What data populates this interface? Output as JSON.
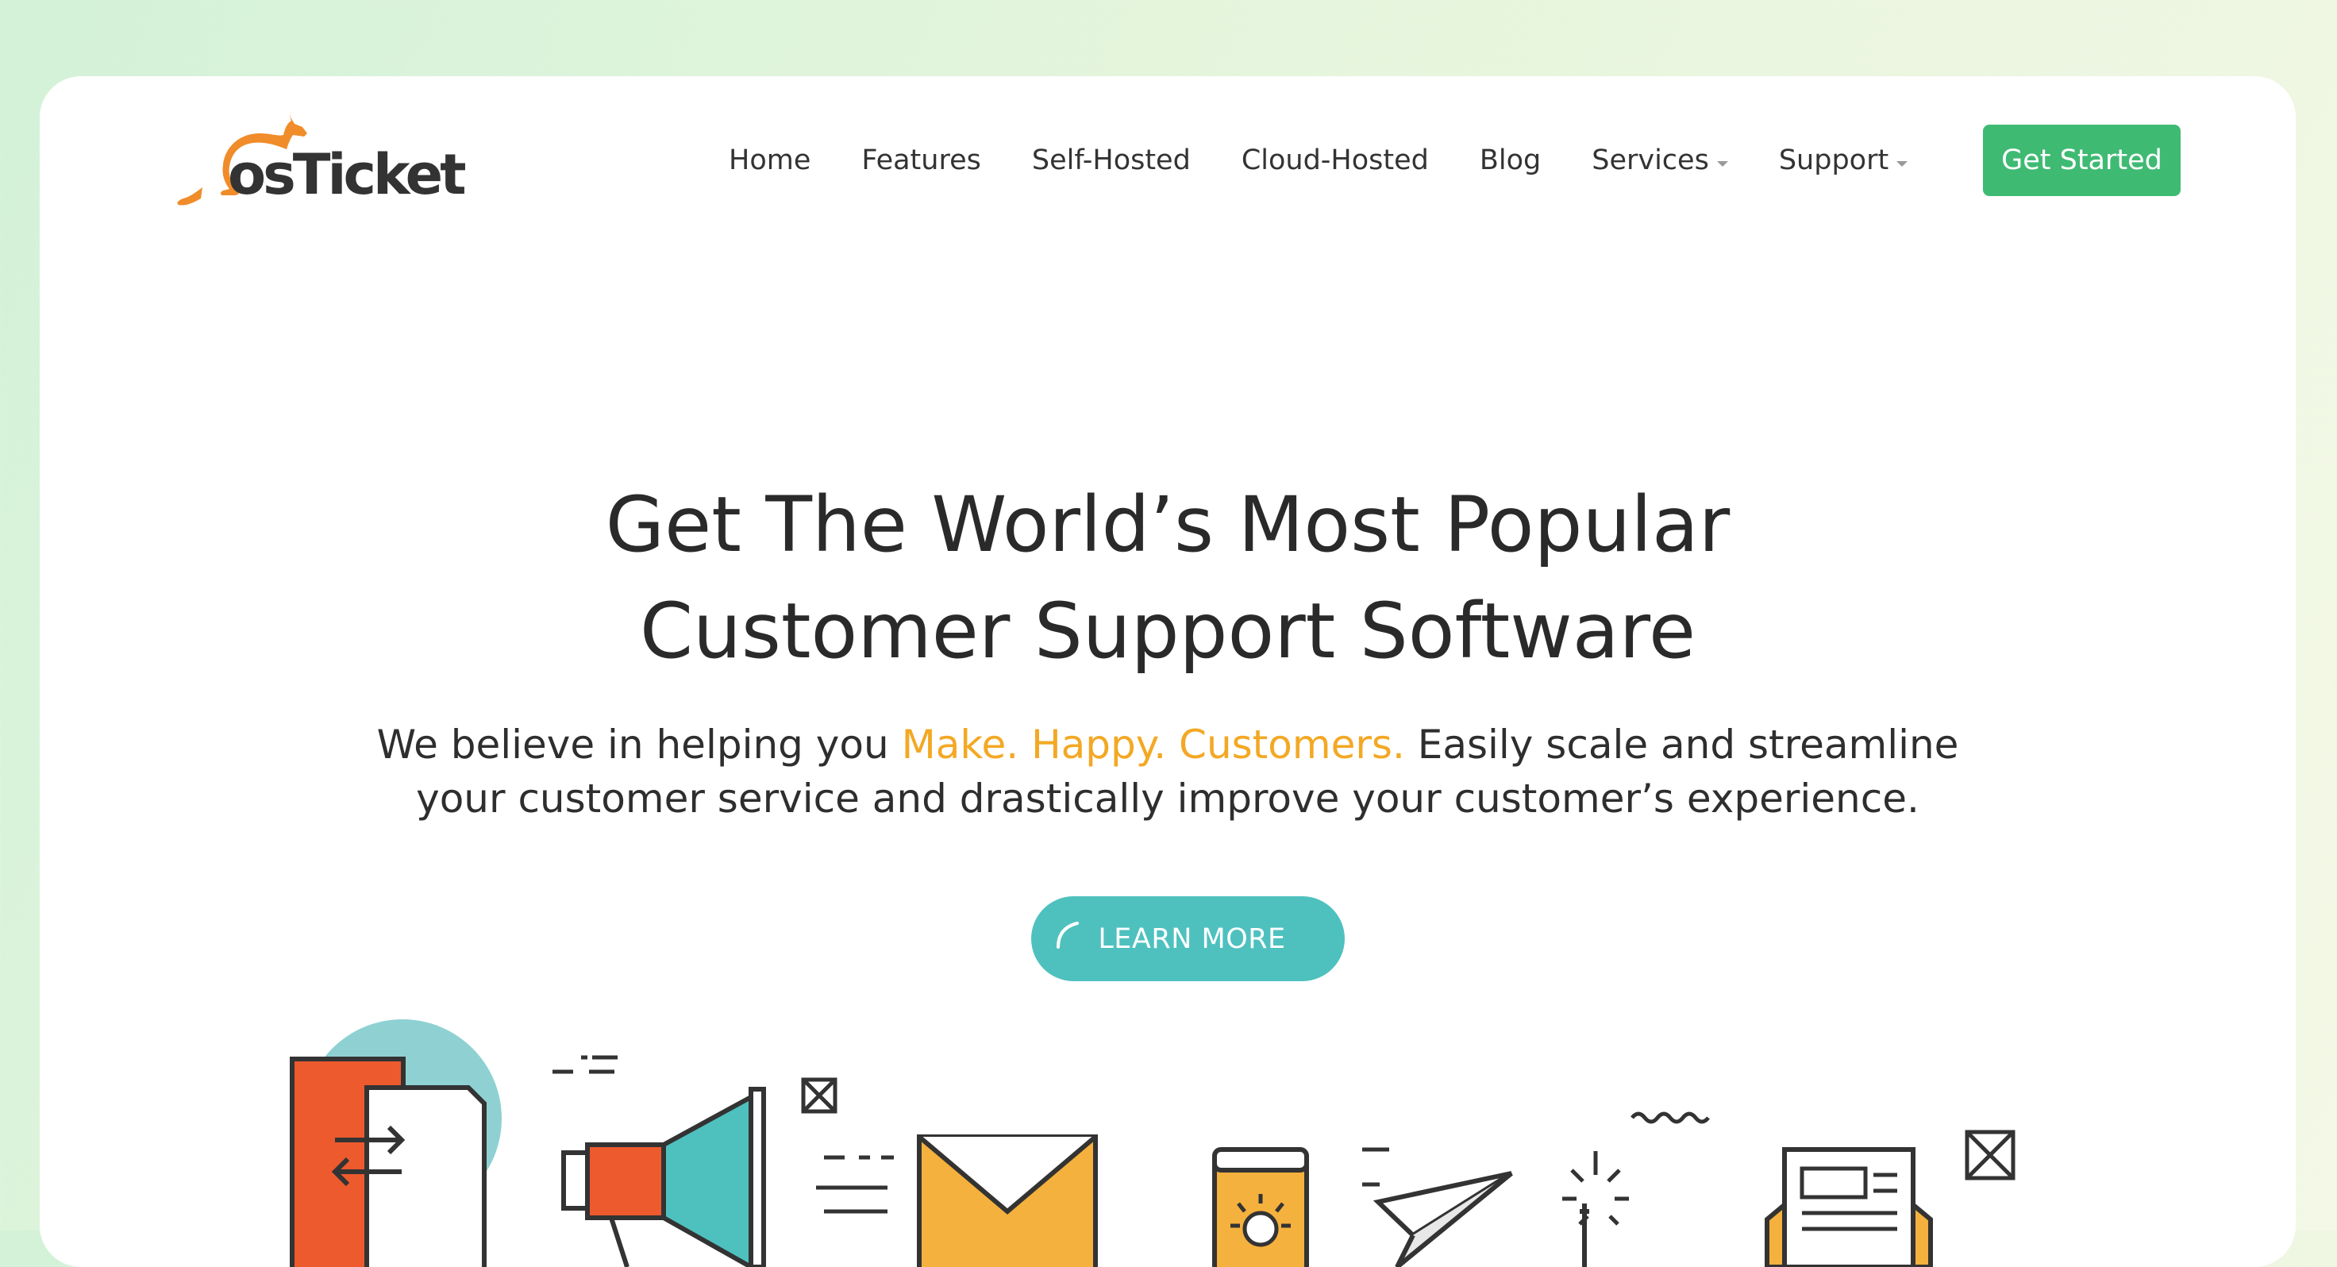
{
  "brand": {
    "logo_text": "osTicket",
    "accent": "#f08c2a"
  },
  "nav": {
    "items": [
      {
        "label": "Home",
        "dropdown": false
      },
      {
        "label": "Features",
        "dropdown": false
      },
      {
        "label": "Self-Hosted",
        "dropdown": false
      },
      {
        "label": "Cloud-Hosted",
        "dropdown": false
      },
      {
        "label": "Blog",
        "dropdown": false
      },
      {
        "label": "Services",
        "dropdown": true
      },
      {
        "label": "Support",
        "dropdown": true
      }
    ],
    "cta_label": "Get Started",
    "cta_color": "#3fba73"
  },
  "hero": {
    "title_line1": "Get The World’s Most Popular",
    "title_line2": "Customer Support Software",
    "sub_before": "We believe in helping you ",
    "sub_highlight": "Make. Happy. Customers.",
    "sub_after": " Easily scale and streamline",
    "sub_line2": "your customer service and drastically improve your customer’s experience.",
    "highlight_color": "#f3a824",
    "button_label": "LEARN MORE",
    "button_color": "#4ec1bf"
  },
  "illustration": {
    "icons": [
      "document-transfer-icon",
      "megaphone-icon",
      "envelope-icon",
      "smartphone-icon",
      "paper-plane-icon",
      "sparkle-icon",
      "newspaper-icon",
      "close-box-icon"
    ]
  }
}
